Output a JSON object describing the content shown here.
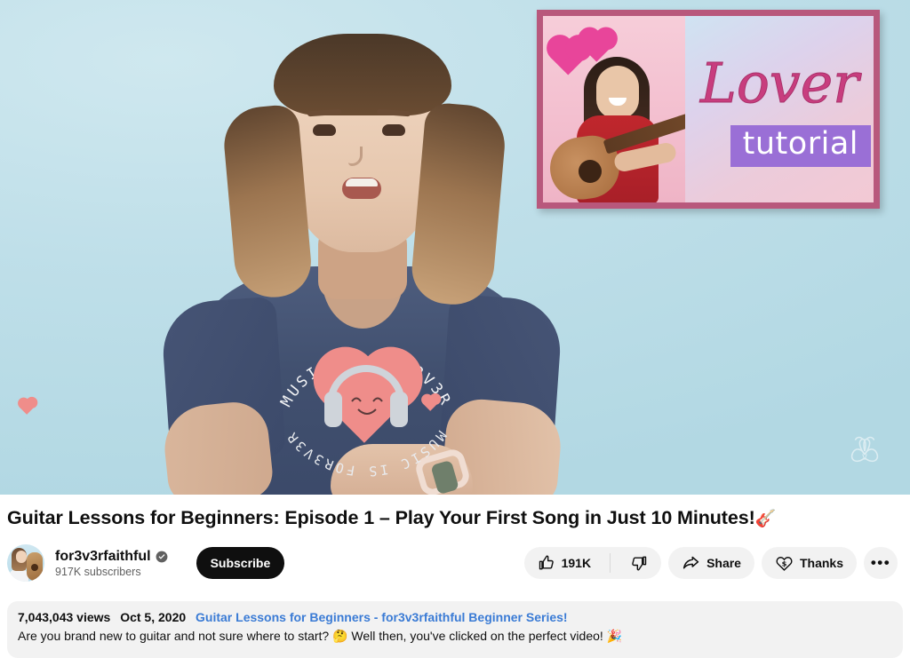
{
  "player": {
    "background_color": "#bfe1ea",
    "watermark_icon": "butterfly-watermark",
    "shirt_text_top": "MUSIC IS FOR3V3R",
    "shirt_text_bottom": "MUSIC IS FOR3V3R"
  },
  "overlay_card": {
    "title_script": "Lover",
    "badge_label": "tutorial",
    "border_color": "#b8587c",
    "badge_color": "#9a6fd6",
    "heart_color": "#e8459a"
  },
  "video": {
    "title": "Guitar Lessons for Beginners: Episode 1 – Play Your First Song in Just 10 Minutes!",
    "title_emoji": "🎸"
  },
  "owner": {
    "channel_name": "for3v3rfaithful",
    "verified_icon": "verified-badge-icon",
    "subscribers": "917K subscribers",
    "subscribe_label": "Subscribe",
    "avatar_icon": "channel-avatar"
  },
  "actions": {
    "like_icon": "thumbs-up-icon",
    "like_count": "191K",
    "dislike_icon": "thumbs-down-icon",
    "share_icon": "share-arrow-icon",
    "share_label": "Share",
    "thanks_icon": "heart-dollar-icon",
    "thanks_label": "Thanks",
    "more_icon": "more-horizontal-icon",
    "more_label": "•••"
  },
  "description": {
    "views": "7,043,043 views",
    "date": "Oct 5, 2020",
    "link_text": "Guitar Lessons for Beginners - for3v3rfaithful Beginner Series!",
    "body_part1": "Are you brand new to guitar and not sure where to start? ",
    "body_emoji1": "🤔",
    "body_part2": " Well then, you've clicked on the perfect video! ",
    "body_emoji2": "🎉",
    "background_color": "#f2f2f2",
    "link_color": "#3a7bd5"
  }
}
